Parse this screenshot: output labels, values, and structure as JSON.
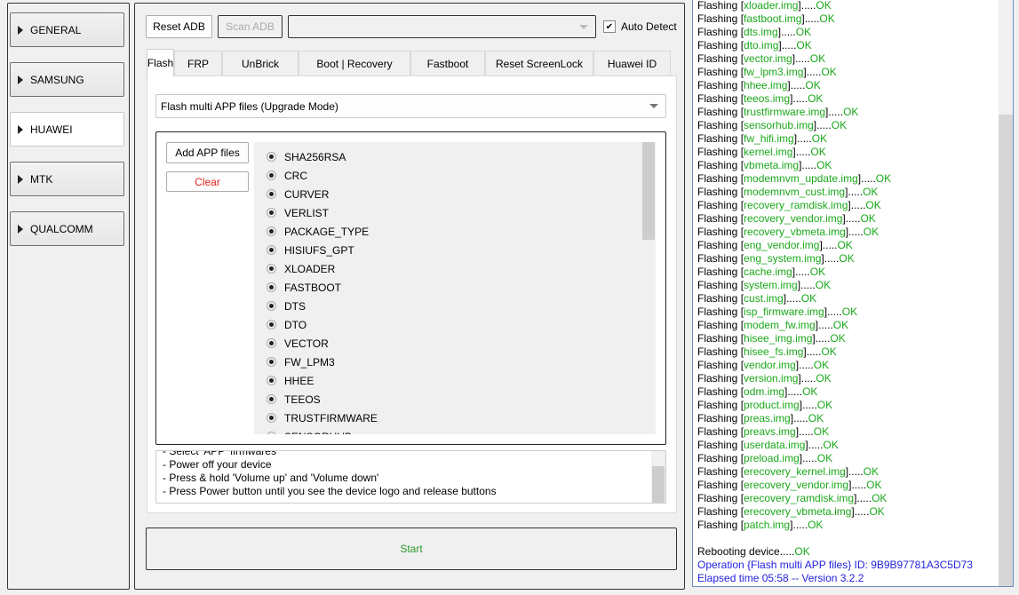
{
  "sidebar": {
    "items": [
      {
        "label": "GENERAL",
        "selected": false
      },
      {
        "label": "SAMSUNG",
        "selected": false
      },
      {
        "label": "HUAWEI",
        "selected": true
      },
      {
        "label": "MTK",
        "selected": false
      },
      {
        "label": "QUALCOMM",
        "selected": false
      }
    ]
  },
  "toolbar": {
    "reset_adb": "Reset ADB",
    "scan_adb": "Scan ADB",
    "device_select": "",
    "auto_detect": "Auto Detect",
    "auto_detect_checked": true
  },
  "tabs": [
    "Flash",
    "FRP",
    "UnBrick",
    "Boot | Recovery",
    "Fastboot",
    "Reset ScreenLock",
    "Huawei ID"
  ],
  "active_tab": "Flash",
  "flash": {
    "mode": "Flash multi APP files (Upgrade Mode)",
    "add_files": "Add APP files",
    "clear": "Clear",
    "partitions": [
      "SHA256RSA",
      "CRC",
      "CURVER",
      "VERLIST",
      "PACKAGE_TYPE",
      "HISIUFS_GPT",
      "XLOADER",
      "FASTBOOT",
      "DTS",
      "DTO",
      "VECTOR",
      "FW_LPM3",
      "HHEE",
      "TEEOS",
      "TRUSTFIRMWARE",
      "SENSORHUB"
    ],
    "instructions": [
      "- Select 'APP' firmwares",
      "- Power off your device",
      "- Press & hold 'Volume up' and 'Volume down'",
      "- Press Power button until you see the device logo and release buttons"
    ],
    "start": "Start"
  },
  "log": {
    "prefix": "Flashing",
    "ok": "OK",
    "dots": ".....",
    "files": [
      "xloader.img",
      "fastboot.img",
      "dts.img",
      "dto.img",
      "vector.img",
      "fw_lpm3.img",
      "hhee.img",
      "teeos.img",
      "trustfirmware.img",
      "sensorhub.img",
      "fw_hifi.img",
      "kernel.img",
      "vbmeta.img",
      "modemnvm_update.img",
      "modemnvm_cust.img",
      "recovery_ramdisk.img",
      "recovery_vendor.img",
      "recovery_vbmeta.img",
      "eng_vendor.img",
      "eng_system.img",
      "cache.img",
      "system.img",
      "cust.img",
      "isp_firmware.img",
      "modem_fw.img",
      "hisee_img.img",
      "hisee_fs.img",
      "vendor.img",
      "version.img",
      "odm.img",
      "product.img",
      "preas.img",
      "preavs.img",
      "userdata.img",
      "preload.img",
      "erecovery_kernel.img",
      "erecovery_vendor.img",
      "erecovery_ramdisk.img",
      "erecovery_vbmeta.img",
      "patch.img"
    ],
    "reboot": "Rebooting device.....",
    "operation": "Operation {Flash multi APP files} ID: 9B9B97781A3C5D73",
    "elapsed": "Elapsed time 05:58 -- Version 3.2.2"
  },
  "colors": {
    "ok": "#1aa81a",
    "info": "#2222dd",
    "clear": "#e02020",
    "start": "#2a9a2a"
  }
}
